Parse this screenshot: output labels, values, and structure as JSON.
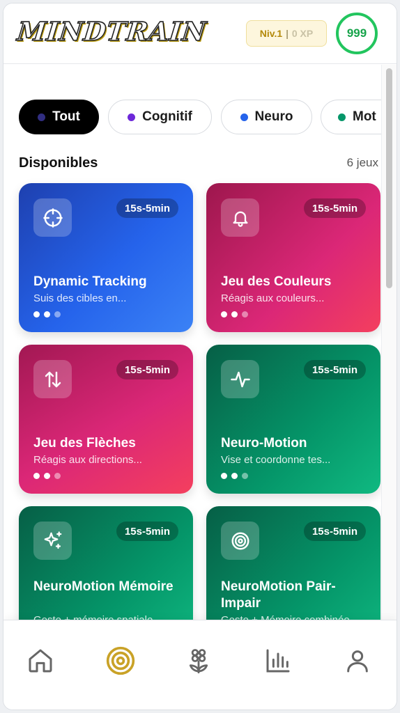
{
  "header": {
    "logo_text": "MINDTRAIN",
    "level": "Niv.1",
    "level_separator": "|",
    "xp": "0 XP",
    "score": "999",
    "colors": {
      "level_text": "#b3890a",
      "score_ring": "#22c55e"
    }
  },
  "filters": [
    {
      "label": "Tout",
      "dot_color": "#312e81",
      "active": true
    },
    {
      "label": "Cognitif",
      "dot_color": "#6d28d9",
      "active": false
    },
    {
      "label": "Neuro",
      "dot_color": "#2563eb",
      "active": false
    },
    {
      "label": "Mot",
      "dot_color": "#059669",
      "active": false
    }
  ],
  "section": {
    "title": "Disponibles",
    "count": "6 jeux"
  },
  "games": [
    {
      "title": "Dynamic Tracking",
      "description": "Suis des cibles en...",
      "duration": "15s-5min",
      "icon": "crosshair-icon",
      "color": "#2563eb"
    },
    {
      "title": "Jeu des Couleurs",
      "description": "Réagis aux couleurs...",
      "duration": "15s-5min",
      "icon": "bell-icon",
      "color": "#db2777"
    },
    {
      "title": "Jeu des Flèches",
      "description": "Réagis aux directions...",
      "duration": "15s-5min",
      "icon": "arrows-up-down-icon",
      "color": "#db2777"
    },
    {
      "title": "Neuro-Motion",
      "description": "Vise et coordonne tes...",
      "duration": "15s-5min",
      "icon": "activity-icon",
      "color": "#059669"
    },
    {
      "title": "NeuroMotion Mémoire",
      "description": "Geste + mémoire spatiale",
      "duration": "15s-5min",
      "icon": "sparkles-icon",
      "color": "#059669"
    },
    {
      "title": "NeuroMotion Pair-Impair",
      "description": "Geste + Mémoire combinée",
      "duration": "15s-5min",
      "icon": "target-icon",
      "color": "#059669"
    }
  ],
  "nav": [
    {
      "name": "home-icon",
      "active": false
    },
    {
      "name": "target-icon",
      "active": true,
      "color": "#c9a227"
    },
    {
      "name": "flower-icon",
      "active": false
    },
    {
      "name": "stats-icon",
      "active": false
    },
    {
      "name": "user-icon",
      "active": false
    }
  ]
}
